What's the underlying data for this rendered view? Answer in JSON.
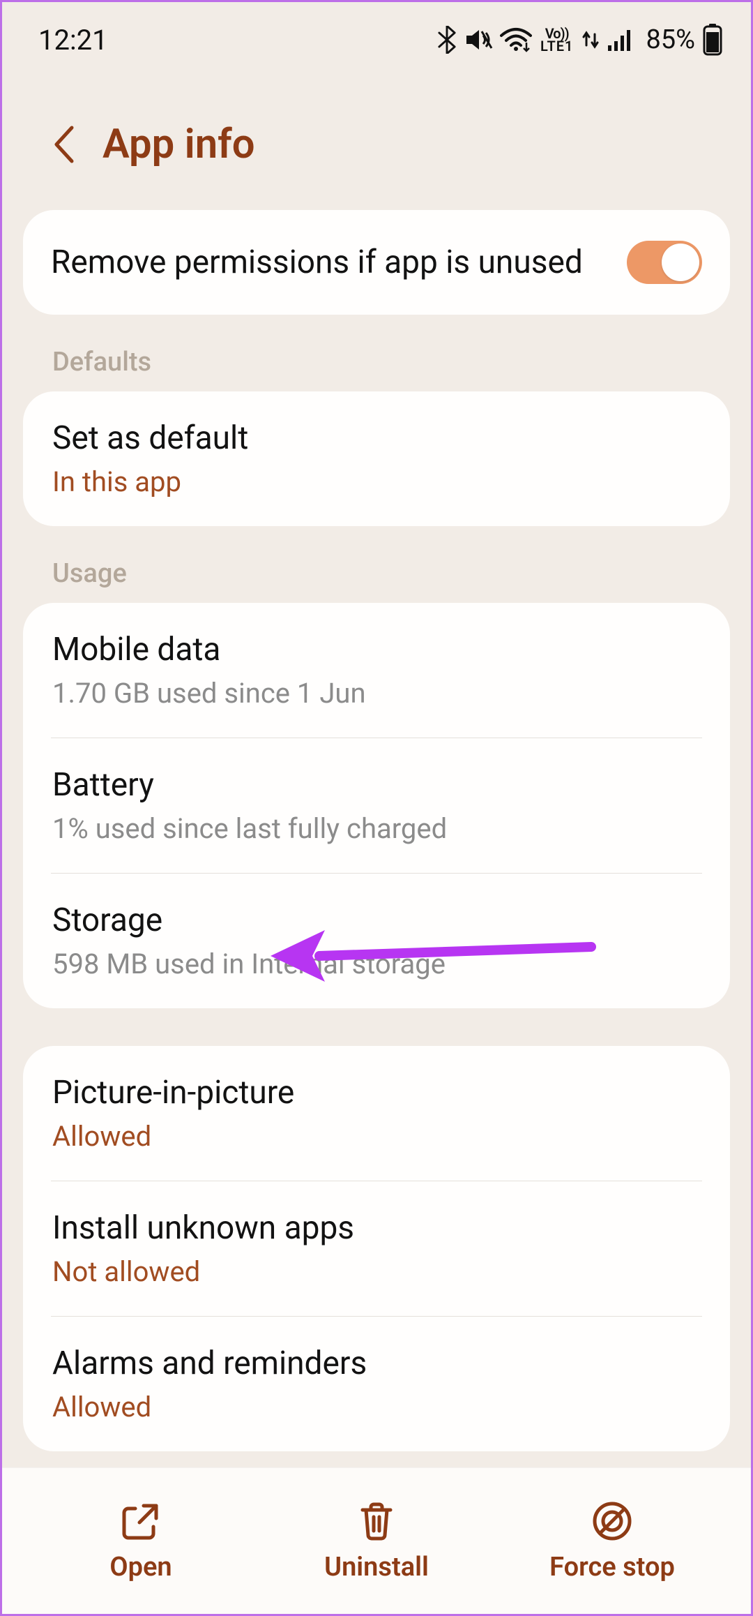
{
  "status": {
    "time": "12:21",
    "battery_pct": "85%"
  },
  "header": {
    "title": "App info"
  },
  "permissions": {
    "remove_permissions_title": "Remove permissions if app is unused",
    "toggle_on": true
  },
  "sections": {
    "defaults_label": "Defaults",
    "usage_label": "Usage"
  },
  "defaults": {
    "set_as_default_title": "Set as default",
    "set_as_default_sub": "In this app"
  },
  "usage": {
    "mobile_data_title": "Mobile data",
    "mobile_data_sub": "1.70 GB used since 1 Jun",
    "battery_title": "Battery",
    "battery_sub": "1% used since last fully charged",
    "storage_title": "Storage",
    "storage_sub": "598 MB used in Internal storage"
  },
  "more": {
    "pip_title": "Picture-in-picture",
    "pip_sub": "Allowed",
    "unknown_title": "Install unknown apps",
    "unknown_sub": "Not allowed",
    "alarms_title": "Alarms and reminders",
    "alarms_sub": "Allowed"
  },
  "bottom": {
    "open": "Open",
    "uninstall": "Uninstall",
    "force_stop": "Force stop"
  }
}
